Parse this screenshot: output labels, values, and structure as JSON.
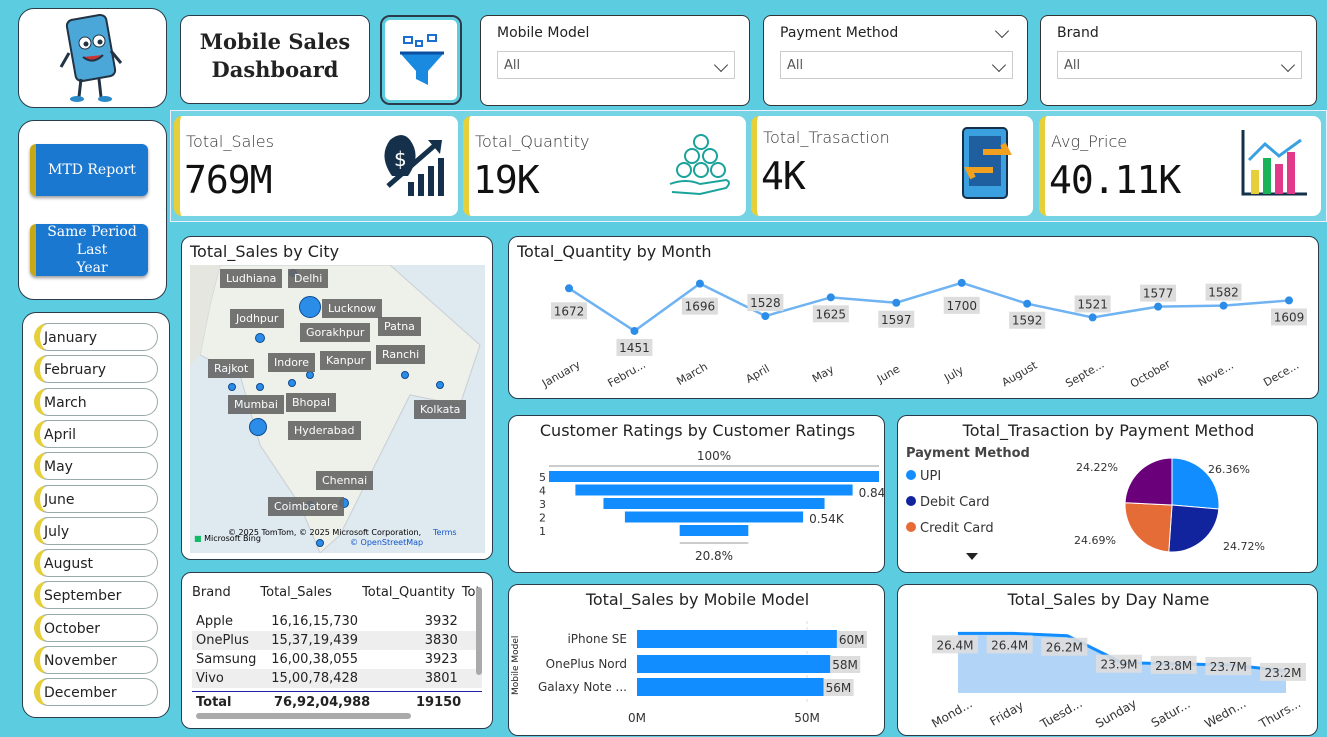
{
  "header": {
    "title_line1": "Mobile Sales",
    "title_line2": "Dashboard"
  },
  "nav": {
    "mtd": "MTD Report",
    "spl_line1": "Same Period Last",
    "spl_line2": "Year"
  },
  "months": [
    "January",
    "February",
    "March",
    "April",
    "May",
    "June",
    "July",
    "August",
    "September",
    "October",
    "November",
    "December"
  ],
  "slicers": [
    {
      "title": "Mobile Model",
      "value": "All"
    },
    {
      "title": "Payment Method",
      "value": "All"
    },
    {
      "title": "Brand",
      "value": "All"
    }
  ],
  "kpis": [
    {
      "label": "Total_Sales",
      "value": "769M"
    },
    {
      "label": "Total_Quantity",
      "value": "19K"
    },
    {
      "label": "Total_Trasaction",
      "value": "4K"
    },
    {
      "label": "Avg_Price",
      "value": "40.11K"
    }
  ],
  "map": {
    "title": "Total_Sales by City",
    "cities": [
      "Ludhiana",
      "Delhi",
      "Lucknow",
      "Jodhpur",
      "Gorakhpur",
      "Patna",
      "Ranchi",
      "Rajkot",
      "Indore",
      "Kanpur",
      "Mumbai",
      "Bhopal",
      "Kolkata",
      "Hyderabad",
      "Chennai",
      "Coimbatore"
    ],
    "copyright": "© 2025 TomTom, © 2025 Microsoft Corporation,",
    "terms": "Terms",
    "osm": "© OpenStreetMap",
    "bing": "Microsoft Bing"
  },
  "table": {
    "headers": [
      "Brand",
      "Total_Sales",
      "Total_Quantity",
      "Tot"
    ],
    "rows": [
      [
        "Apple",
        "16,16,15,730",
        "3932"
      ],
      [
        "OnePlus",
        "15,37,19,439",
        "3830"
      ],
      [
        "Samsung",
        "16,00,38,055",
        "3923"
      ],
      [
        "Vivo",
        "15,00,78,428",
        "3801"
      ]
    ],
    "total": [
      "Total",
      "76,92,04,988",
      "19150"
    ]
  },
  "chart_data": [
    {
      "type": "line",
      "title": "Total_Quantity by Month",
      "categories": [
        "January",
        "Febru...",
        "March",
        "April",
        "May",
        "June",
        "July",
        "August",
        "Septe...",
        "October",
        "Nove...",
        "Dece..."
      ],
      "values": [
        1672,
        1451,
        1696,
        1528,
        1625,
        1597,
        1700,
        1592,
        1521,
        1577,
        1582,
        1609
      ]
    },
    {
      "type": "bar",
      "title": "Customer Ratings by Customer Ratings",
      "categories": [
        "5",
        "4",
        "3",
        "2",
        "1"
      ],
      "values": [
        1.0,
        0.84,
        0.67,
        0.54,
        0.208
      ],
      "labels": [
        "100%",
        "0.84K",
        "0.54K",
        "20.8%"
      ]
    },
    {
      "type": "pie",
      "title": "Total_Trasaction by Payment Method",
      "legend_title": "Payment Method",
      "series": [
        {
          "name": "UPI",
          "value": 26.36,
          "color": "#118dff"
        },
        {
          "name": "Debit Card",
          "value": 24.72,
          "color": "#12239e"
        },
        {
          "name": "Credit Card",
          "value": 24.69,
          "color": "#e66c37"
        },
        {
          "name": "",
          "value": 24.22,
          "color": "#6b007b"
        }
      ],
      "labels": [
        "26.36%",
        "24.72%",
        "24.69%",
        "24.22%"
      ]
    },
    {
      "type": "bar",
      "title": "Total_Sales by Mobile Model",
      "ylabel": "Mobile Model",
      "categories": [
        "iPhone SE",
        "OnePlus Nord",
        "Galaxy Note ..."
      ],
      "values": [
        60,
        58,
        56
      ],
      "labels": [
        "60M",
        "58M",
        "56M"
      ],
      "ticks": [
        "0M",
        "50M"
      ]
    },
    {
      "type": "area",
      "title": "Total_Sales by Day Name",
      "categories": [
        "Mond...",
        "Friday",
        "Tuesd...",
        "Sunday",
        "Satur...",
        "Wedn...",
        "Thurs..."
      ],
      "values": [
        26.4,
        26.4,
        26.2,
        23.9,
        23.8,
        23.7,
        23.2
      ],
      "labels": [
        "26.4M",
        "26.4M",
        "26.2M",
        "23.9M",
        "23.8M",
        "23.7M",
        "23.2M"
      ]
    }
  ]
}
